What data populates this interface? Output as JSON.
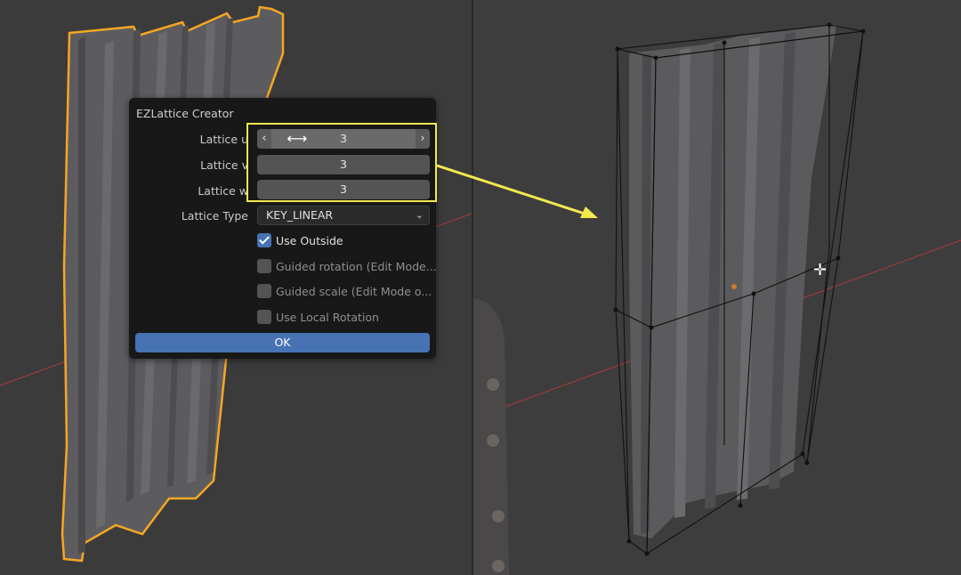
{
  "dialog": {
    "title": "EZLattice Creator",
    "fields": [
      {
        "label": "Lattice u",
        "value": "3"
      },
      {
        "label": "Lattice v",
        "value": "3"
      },
      {
        "label": "Lattice w",
        "value": "3"
      }
    ],
    "lattice_type": {
      "label": "Lattice Type",
      "value": "KEY_LINEAR"
    },
    "options": [
      {
        "label": "Use Outside",
        "checked": true
      },
      {
        "label": "Guided rotation (Edit Mode...",
        "checked": false
      },
      {
        "label": "Guided scale (Edit Mode o...",
        "checked": false
      },
      {
        "label": "Use Local Rotation",
        "checked": false
      }
    ],
    "ok_label": "OK"
  },
  "colors": {
    "selection_outline": "#f5a623",
    "annotation": "#f2e94e",
    "accent": "#4772b3",
    "axis_line": "#9a3b3b"
  },
  "icons": [
    "chevron-left-icon",
    "chevron-right-icon",
    "horizontal-resize-cursor-icon",
    "chevron-down-icon",
    "checkmark-icon",
    "crosshair-cursor-icon"
  ]
}
